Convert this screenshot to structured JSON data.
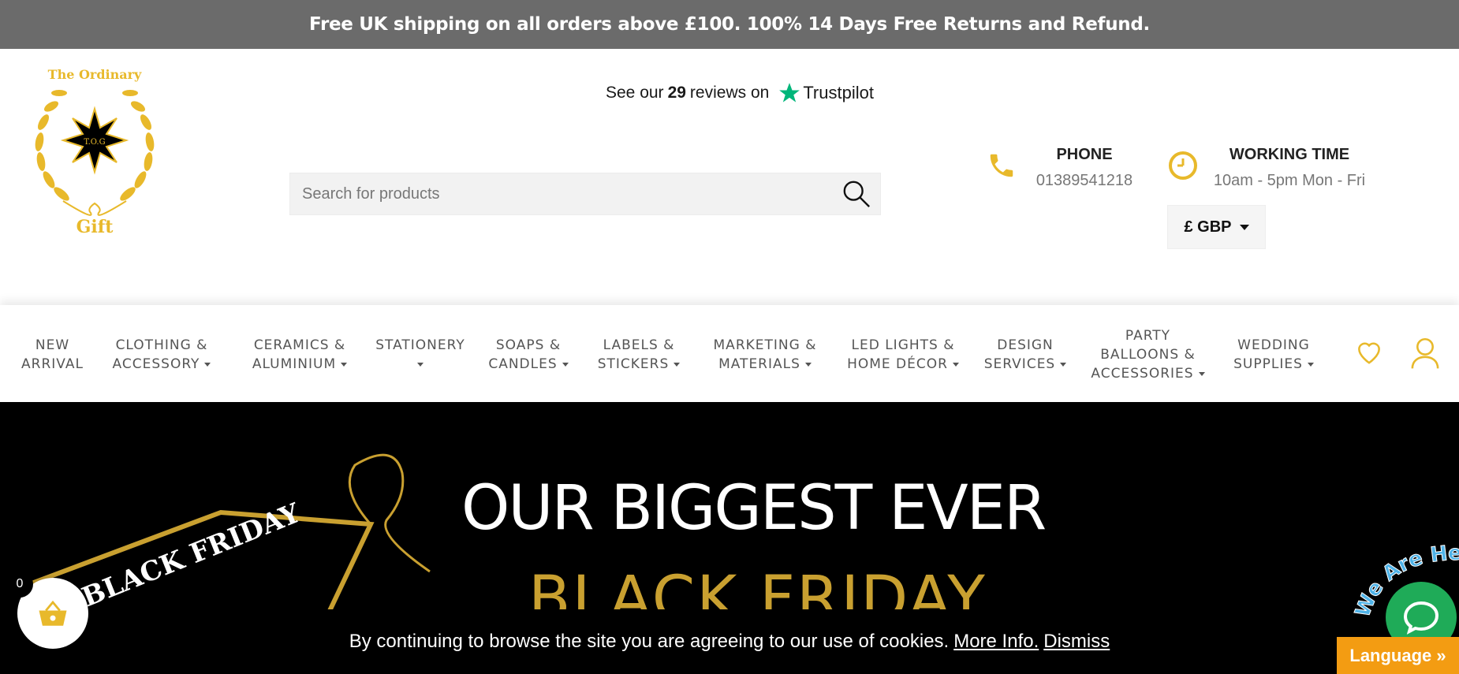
{
  "announcement": "Free UK shipping on all orders above £100. 100% 14 Days Free Returns and Refund.",
  "logo": {
    "top_text": "The Ordinary",
    "bottom_text": "Gift",
    "monogram": "T.O.G"
  },
  "trustpilot": {
    "prefix": "See our",
    "count": "29",
    "suffix": "reviews on",
    "brand": "Trustpilot"
  },
  "search": {
    "placeholder": "Search for products"
  },
  "phone": {
    "label": "PHONE",
    "value": "01389541218"
  },
  "working": {
    "label": "WORKING TIME",
    "value": "10am - 5pm Mon - Fri"
  },
  "currency": {
    "label": "£ GBP"
  },
  "nav": [
    {
      "line1": "NEW",
      "line2": "ARRIVAL"
    },
    {
      "line1": "CLOTHING &",
      "line2": "ACCESSORY"
    },
    {
      "line1": "CERAMICS &",
      "line2": "ALUMINIUM"
    },
    {
      "line1": "STATIONERY",
      "line2": ""
    },
    {
      "line1": "SOAPS &",
      "line2": "CANDLES"
    },
    {
      "line1": "LABELS &",
      "line2": "STICKERS"
    },
    {
      "line1": "MARKETING &",
      "line2": "MATERIALS"
    },
    {
      "line1": "LED LIGHTS &",
      "line2": "HOME DÉCOR"
    },
    {
      "line1": "DESIGN",
      "line2": "SERVICES"
    },
    {
      "line1": "PARTY",
      "line2": "BALLOONS &",
      "line3": "ACCESSORIES"
    },
    {
      "line1": "WEDDING",
      "line2": "SUPPLIES"
    }
  ],
  "hero": {
    "headline": "OUR BIGGEST EVER",
    "subheadline": "BLACK FRIDAY",
    "tag": "BLACK FRIDAY"
  },
  "cookie": {
    "text": "By continuing to browse the site you are agreeing to our use of cookies.",
    "more": "More Info.",
    "dismiss": "Dismiss"
  },
  "cart": {
    "count": "0"
  },
  "chat": {
    "badge": "We Are Here"
  },
  "language": {
    "label": "Language »"
  },
  "colors": {
    "accent": "#e8b92b",
    "topbar": "#6b6b6b",
    "trustpilot_green": "#00b67a",
    "chat_green": "#1fab58",
    "language_orange": "#f39c12"
  }
}
